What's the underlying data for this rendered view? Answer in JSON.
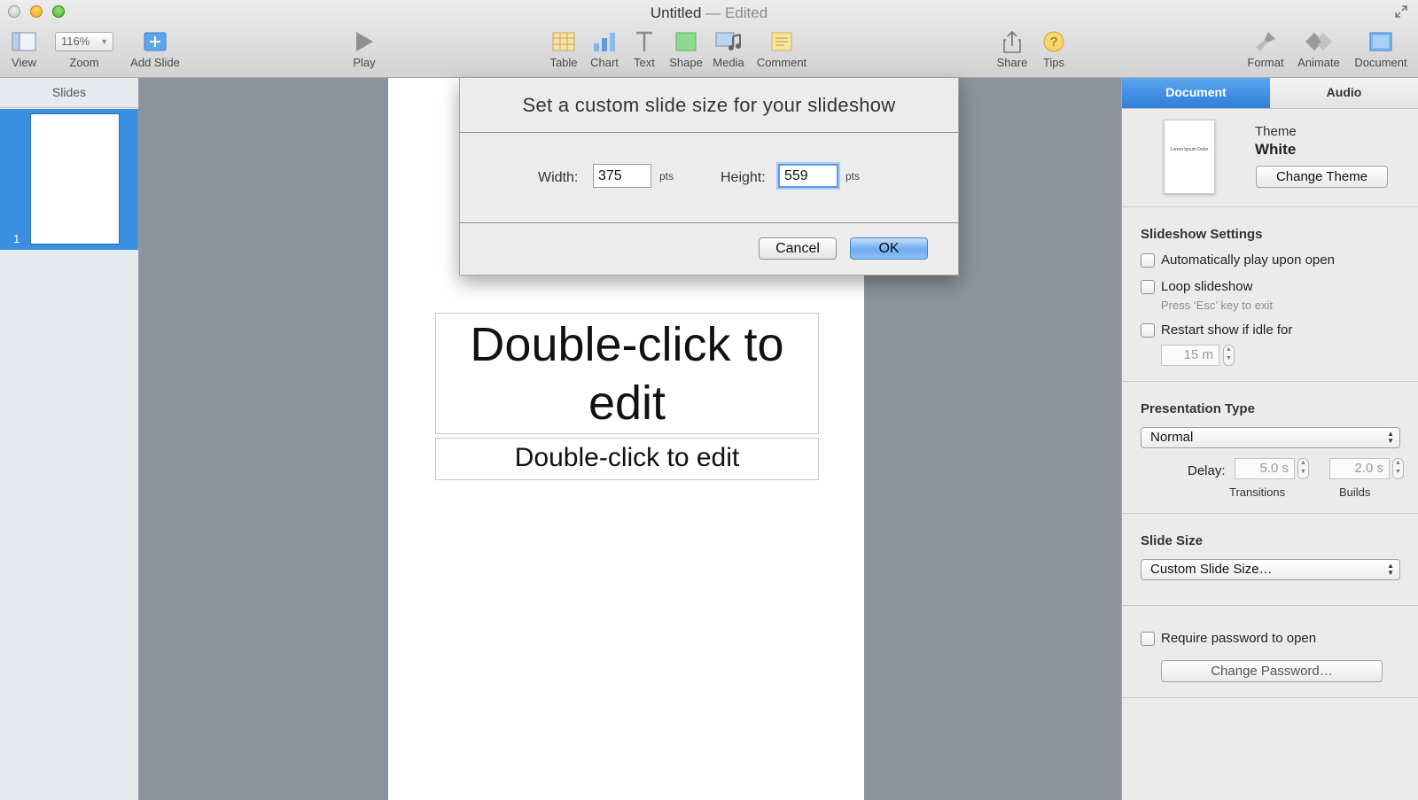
{
  "window": {
    "title": "Untitled",
    "separator": "—",
    "status": "Edited"
  },
  "toolbar": {
    "view": "View",
    "zoom_value": "116%",
    "zoom": "Zoom",
    "add_slide": "Add Slide",
    "play": "Play",
    "table": "Table",
    "chart": "Chart",
    "text": "Text",
    "shape": "Shape",
    "media": "Media",
    "comment": "Comment",
    "share": "Share",
    "tips": "Tips",
    "format": "Format",
    "animate": "Animate",
    "document": "Document"
  },
  "slides_panel": {
    "header": "Slides",
    "slide_number": "1"
  },
  "slide": {
    "title_placeholder": "Double-click to edit",
    "body_placeholder": "Double-click to edit"
  },
  "dialog": {
    "title": "Set a custom slide size for your slideshow",
    "width_label": "Width:",
    "width_value": "375",
    "height_label": "Height:",
    "height_value": "559",
    "unit": "pts",
    "cancel": "Cancel",
    "ok": "OK"
  },
  "inspector": {
    "tabs": [
      "Document",
      "Audio"
    ],
    "theme_label": "Theme",
    "theme_name": "White",
    "theme_thumb_text": "Lorem Ipsum Dolor",
    "change_theme": "Change Theme",
    "slideshow_settings": {
      "heading": "Slideshow Settings",
      "auto_play": "Automatically play upon open",
      "loop": "Loop slideshow",
      "loop_hint": "Press ‘Esc’ key to exit",
      "restart": "Restart show if idle for",
      "idle_value": "15 m"
    },
    "presentation_type": {
      "heading": "Presentation Type",
      "selected": "Normal",
      "delay_label": "Delay:",
      "transitions_value": "5.0 s",
      "builds_value": "2.0 s",
      "transitions_label": "Transitions",
      "builds_label": "Builds"
    },
    "slide_size": {
      "heading": "Slide Size",
      "selected": "Custom Slide Size…"
    },
    "password": {
      "require": "Require password to open",
      "change": "Change Password…"
    }
  },
  "colors": {
    "accent": "#3b8fe0",
    "canvas": "#8c939c"
  }
}
